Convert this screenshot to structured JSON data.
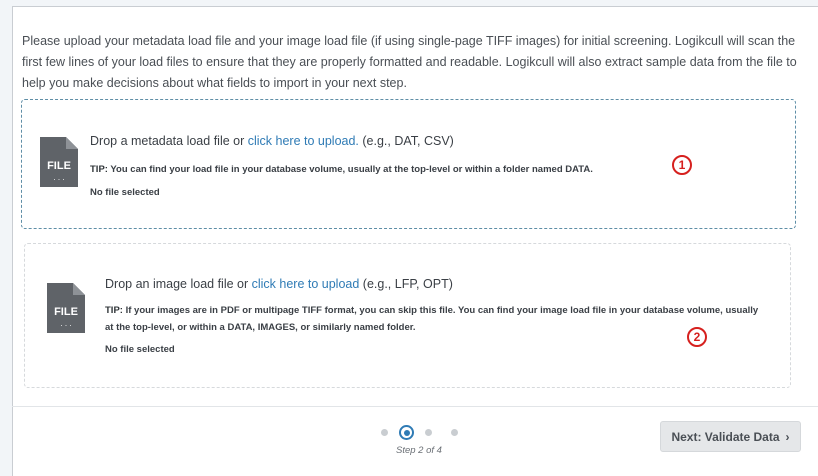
{
  "intro_text": "Please upload your metadata load file and your image load file (if using single-page TIFF images) for initial screening. Logikcull will scan the first few lines of your load files to ensure that they are properly formatted and readable. Logikcull will also extract sample data from the file to help you make decisions about what fields to import in your next step.",
  "metadata_zone": {
    "icon": "file-icon",
    "icon_label": "FILE",
    "title_prefix": "Drop a metadata load file or ",
    "link_text": "click here to upload.",
    "title_suffix": " (e.g., DAT, CSV)",
    "tip_label": "TIP:",
    "tip_text": " You can find your load file in your database volume, usually at the top-level or within a folder named DATA.",
    "status": "No file selected",
    "badge": "1"
  },
  "image_zone": {
    "icon": "file-icon",
    "icon_label": "FILE",
    "title_prefix": "Drop an image load file or ",
    "link_text": "click here to upload",
    "title_suffix": " (e.g., LFP, OPT)",
    "tip_label": "TIP:",
    "tip_text": " If your images are in PDF or multipage TIFF format, you can skip this file. You can find your image load file in your database volume, usually at the top-level, or within a DATA, IMAGES, or similarly named folder.",
    "status": "No file selected",
    "badge": "2"
  },
  "stepper": {
    "step_text": "Step 2 of 4",
    "current": 2,
    "total": 4
  },
  "next_button": {
    "label": "Next: Validate Data",
    "icon": "chevron-right-icon",
    "chevron": "›"
  },
  "colors": {
    "accent": "#2f7bb5",
    "badge_red": "#d6201e",
    "active_zone_border": "#5e8ea6"
  }
}
